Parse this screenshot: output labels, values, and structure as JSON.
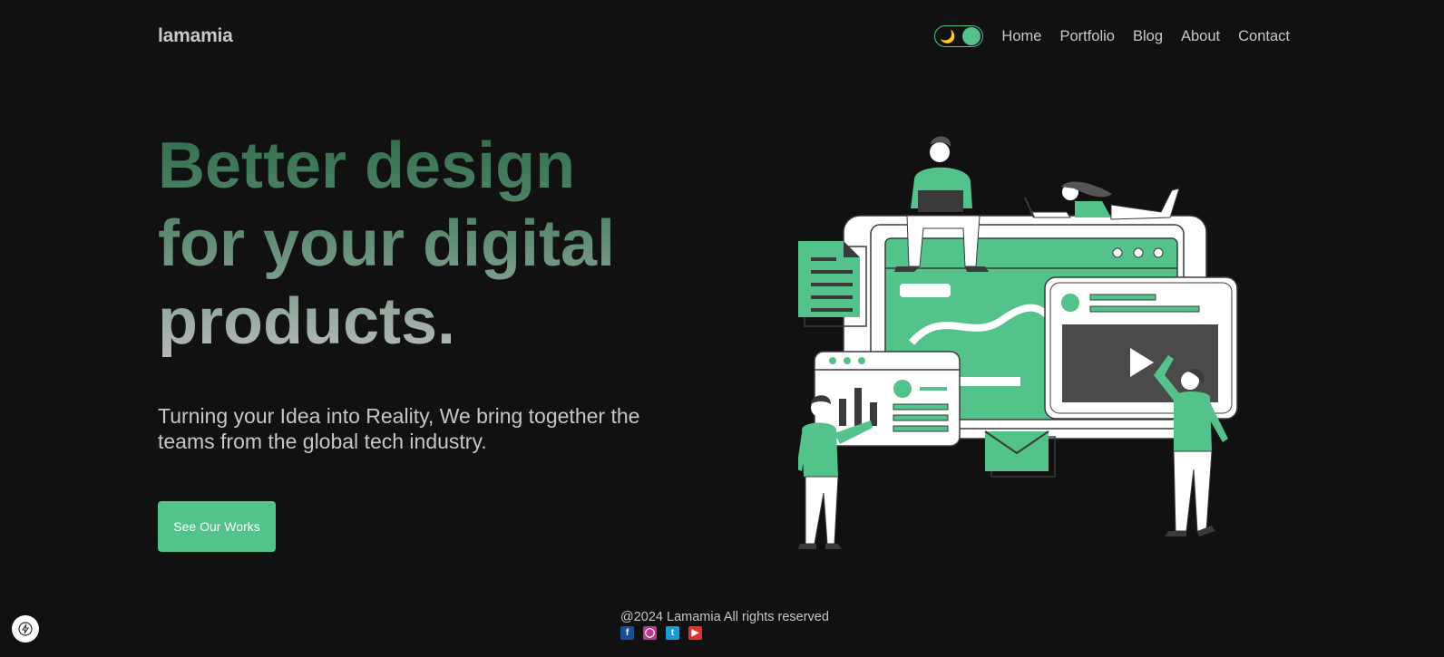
{
  "brand": {
    "logo": "lamamia"
  },
  "theme_toggle": {
    "icon": "moon-icon",
    "state": "dark"
  },
  "nav": {
    "links": [
      "Home",
      "Portfolio",
      "Blog",
      "About",
      "Contact"
    ]
  },
  "hero": {
    "title": "Better design\nfor your digital\nproducts.",
    "description": "Turning your Idea into Reality, We bring together the teams from the global tech industry.",
    "cta_label": "See Our Works",
    "illustration": "team-working-on-digital-product-illustration"
  },
  "footer": {
    "copyright": "@2024 Lamamia All rights reserved",
    "social": [
      "facebook-icon",
      "instagram-icon",
      "twitter-icon",
      "youtube-icon"
    ]
  },
  "colors": {
    "background": "#111111",
    "accent": "#53c28b",
    "text": "#c6c6c6"
  }
}
